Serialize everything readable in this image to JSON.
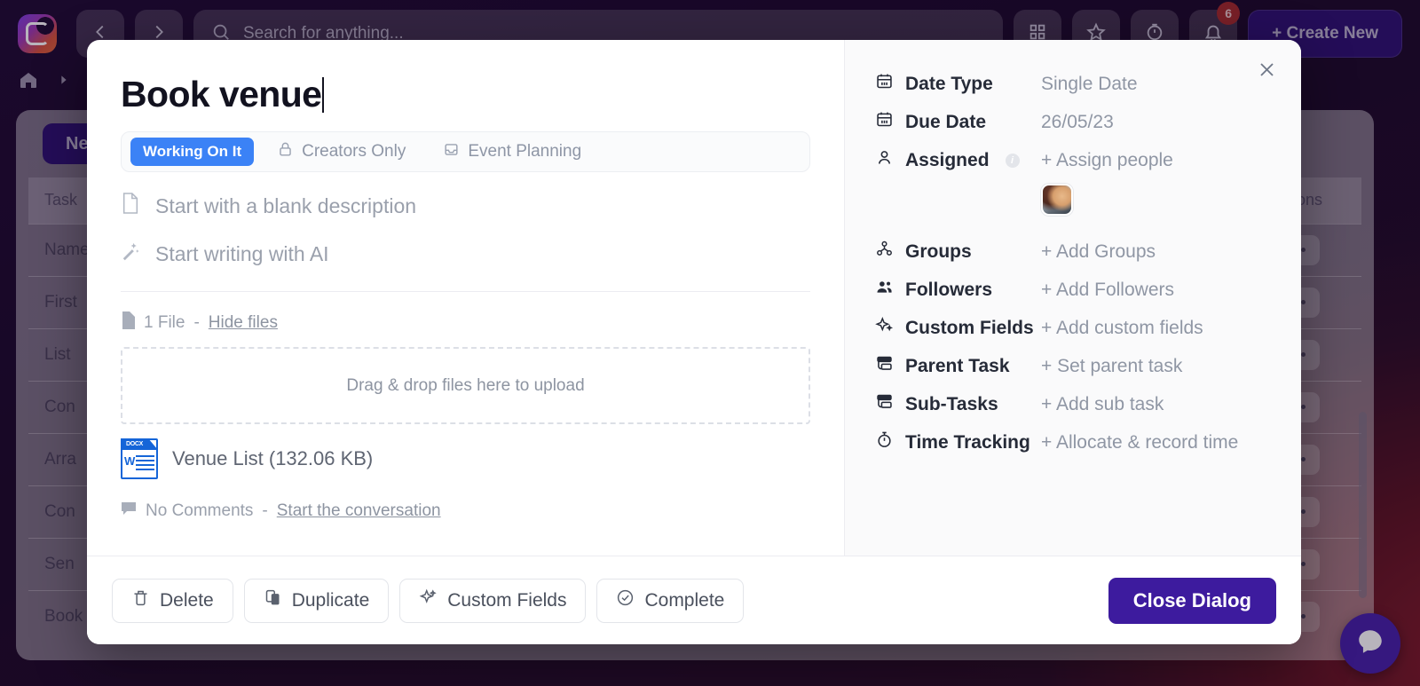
{
  "topbar": {
    "logo_name": "app-logo",
    "back_icon": "chevron-left-icon",
    "forward_icon": "chevron-right-icon",
    "search": {
      "placeholder": "Search for anything...",
      "value": ""
    },
    "actions": [
      {
        "name": "star-icon",
        "label": ""
      },
      {
        "name": "timer-icon",
        "label": ""
      },
      {
        "name": "bell-icon",
        "label": "",
        "badge": "6"
      }
    ],
    "create_new_label": "+ Create New"
  },
  "breadcrumb": {
    "home_icon": "home-icon",
    "chevron_icon": "chevron-right-icon"
  },
  "content": {
    "new_task_label": "New",
    "columns": [
      "Task",
      "Options"
    ],
    "rows": [
      {
        "task": "Name",
        "options": "..."
      },
      {
        "task": "First",
        "options": "..."
      },
      {
        "task": "List",
        "options": "..."
      },
      {
        "task": "Con",
        "options": "..."
      },
      {
        "task": "Arra",
        "options": "..."
      },
      {
        "task": "Con",
        "options": "..."
      },
      {
        "task": "Sen",
        "options": "..."
      },
      {
        "task": "Book",
        "options": "..."
      }
    ]
  },
  "chat_fab": {
    "name": "chat-bubble-icon"
  },
  "modal": {
    "title": "Book venue",
    "close_icon": "close-icon",
    "meta": {
      "status": "Working On It",
      "visibility": "Creators Only",
      "visibility_icon": "lock-icon",
      "board": "Event Planning",
      "board_icon": "inbox-icon"
    },
    "description_options": [
      {
        "icon": "document-icon",
        "label": "Start with a blank description"
      },
      {
        "icon": "magic-wand-icon",
        "label": "Start writing with AI"
      }
    ],
    "files": {
      "count_label": "1 File",
      "separator": "-",
      "toggle_label": "Hide files",
      "dropzone_label": "Drag & drop files here to upload",
      "items": [
        {
          "name": "Venue List (132.06 KB)",
          "type": "DOCX"
        }
      ]
    },
    "comments": {
      "count_label": "No Comments",
      "separator": "-",
      "action_label": "Start the conversation"
    },
    "properties": [
      {
        "icon": "calendar-icon",
        "label": "Date Type",
        "value": "Single Date"
      },
      {
        "icon": "calendar-icon",
        "label": "Due Date",
        "value": "26/05/23"
      },
      {
        "icon": "user-icon",
        "label": "Assigned",
        "value": "+ Assign people",
        "info": "i"
      },
      {
        "icon": "groups-icon",
        "label": "Groups",
        "value": "+ Add Groups"
      },
      {
        "icon": "followers-icon",
        "label": "Followers",
        "value": "+ Add Followers"
      },
      {
        "icon": "sparkle-icon",
        "label": "Custom Fields",
        "value": "+ Add custom fields"
      },
      {
        "icon": "task-icon",
        "label": "Parent Task",
        "value": "+ Set parent task"
      },
      {
        "icon": "task-icon",
        "label": "Sub-Tasks",
        "value": "+ Add sub task"
      },
      {
        "icon": "stopwatch-icon",
        "label": "Time Tracking",
        "value": "+ Allocate & record time"
      }
    ],
    "footer": {
      "delete_label": "Delete",
      "duplicate_label": "Duplicate",
      "custom_fields_label": "Custom Fields",
      "complete_label": "Complete",
      "close_label": "Close Dialog"
    }
  },
  "colors": {
    "accent_purple": "#3d1b9e",
    "status_blue": "#3b82f6",
    "badge_red": "#a32a2a",
    "file_blue": "#1565d8"
  }
}
